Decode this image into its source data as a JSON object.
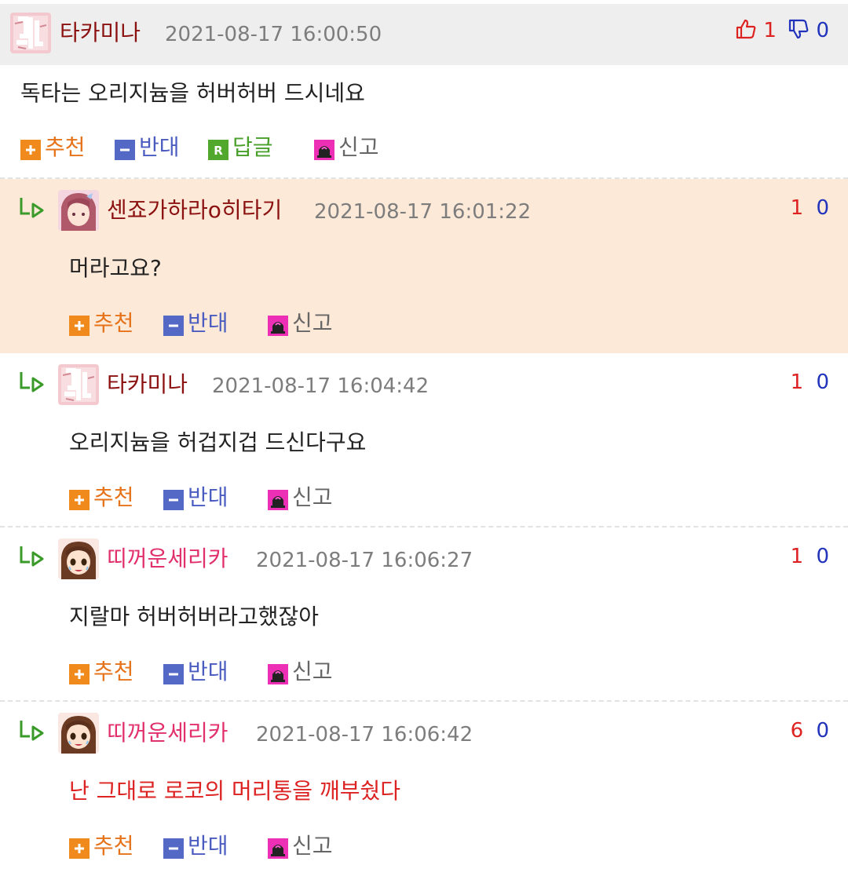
{
  "colors": {
    "nick_dark": "#8b1010",
    "nick_pink": "#e1306c",
    "upvote": "#dd2222",
    "downvote": "#2233bb",
    "highlight_bg": "#fce9d8",
    "recommend": "#f08a1c",
    "oppose": "#5468c6",
    "reply": "#52a82c",
    "report": "#ec2fb5"
  },
  "comments": [
    {
      "nick": "타카미나",
      "time": "2021-08-17 16:00:50",
      "text": "독타는 오리지늄을 허버허버 드시네요",
      "up": "1",
      "down": "0",
      "avatar": "pink-scribble-avatar",
      "actions": {
        "recommend": "추천",
        "oppose": "반대",
        "reply": "답글",
        "report": "신고"
      }
    },
    {
      "nick": "센죠가하라o히타기",
      "time": "2021-08-17 16:01:22",
      "text": "머라고요?",
      "up": "1",
      "down": "0",
      "avatar": "anime-girl-avatar",
      "actions": {
        "recommend": "추천",
        "oppose": "반대",
        "report": "신고"
      }
    },
    {
      "nick": "타카미나",
      "time": "2021-08-17 16:04:42",
      "text": "오리지늄을 허겁지겁 드신다구요",
      "up": "1",
      "down": "0",
      "avatar": "pink-scribble-avatar",
      "actions": {
        "recommend": "추천",
        "oppose": "반대",
        "report": "신고"
      }
    },
    {
      "nick": "띠꺼운세리카",
      "time": "2021-08-17 16:06:27",
      "text": "지랄마 허버허버라고했잖아",
      "up": "1",
      "down": "0",
      "avatar": "crying-girl-avatar",
      "actions": {
        "recommend": "추천",
        "oppose": "반대",
        "report": "신고"
      }
    },
    {
      "nick": "띠꺼운세리카",
      "time": "2021-08-17 16:06:42",
      "text": "난 그대로 로코의 머리통을 깨부쉈다",
      "up": "6",
      "down": "0",
      "avatar": "crying-girl-avatar",
      "actions": {
        "recommend": "추천",
        "oppose": "반대",
        "report": "신고"
      }
    }
  ]
}
